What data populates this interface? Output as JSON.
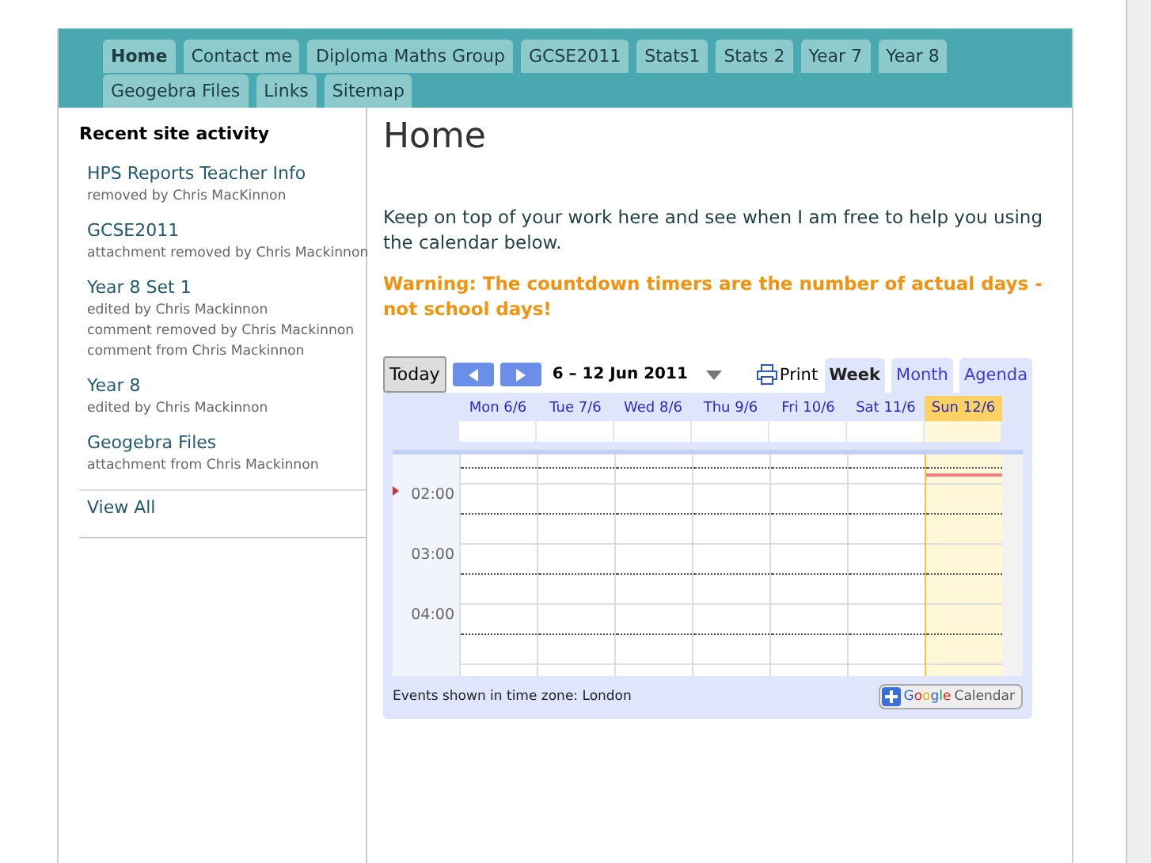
{
  "nav": {
    "tabs": [
      {
        "label": "Home",
        "selected": true
      },
      {
        "label": "Contact me",
        "selected": false
      },
      {
        "label": "Diploma Maths Group",
        "selected": false
      },
      {
        "label": "GCSE2011",
        "selected": false
      },
      {
        "label": "Stats1",
        "selected": false
      },
      {
        "label": "Stats 2",
        "selected": false
      },
      {
        "label": "Year 7",
        "selected": false
      },
      {
        "label": "Year 8",
        "selected": false
      },
      {
        "label": "Geogebra Files",
        "selected": false
      },
      {
        "label": "Links",
        "selected": false
      },
      {
        "label": "Sitemap",
        "selected": false
      }
    ]
  },
  "sidebar": {
    "title": "Recent site activity",
    "activity": [
      {
        "page": "HPS Reports Teacher Info",
        "events": [
          "removed by Chris MacKinnon"
        ]
      },
      {
        "page": "GCSE2011",
        "events": [
          "attachment removed by Chris Mackinnon"
        ]
      },
      {
        "page": "Year 8 Set 1",
        "events": [
          "edited by Chris Mackinnon",
          "comment removed by Chris Mackinnon",
          "comment from Chris Mackinnon"
        ]
      },
      {
        "page": "Year 8",
        "events": [
          "edited by Chris Mackinnon"
        ]
      },
      {
        "page": "Geogebra Files",
        "events": [
          "attachment from Chris Mackinnon"
        ]
      }
    ],
    "view_all": "View All"
  },
  "main": {
    "title": "Home",
    "intro": "Keep on top of your work here and see when I am free to help you using the calendar below.",
    "warning": "Warning: The countdown timers are the number of actual days - not school days!"
  },
  "calendar": {
    "today_button": "Today",
    "date_range": "6 – 12 Jun 2011",
    "print": "Print",
    "views": [
      {
        "label": "Week",
        "selected": true
      },
      {
        "label": "Month",
        "selected": false
      },
      {
        "label": "Agenda",
        "selected": false
      }
    ],
    "days": [
      {
        "label": "Mon 6/6",
        "selected": false
      },
      {
        "label": "Tue 7/6",
        "selected": false
      },
      {
        "label": "Wed 8/6",
        "selected": false
      },
      {
        "label": "Thu 9/6",
        "selected": false
      },
      {
        "label": "Fri 10/6",
        "selected": false
      },
      {
        "label": "Sat 11/6",
        "selected": false
      },
      {
        "label": "Sun 12/6",
        "selected": true
      }
    ],
    "hours": [
      "02:00",
      "03:00",
      "04:00"
    ],
    "timezone_note": "Events shown in time zone: London",
    "badge": {
      "brand": "Google",
      "product": "Calendar"
    }
  }
}
